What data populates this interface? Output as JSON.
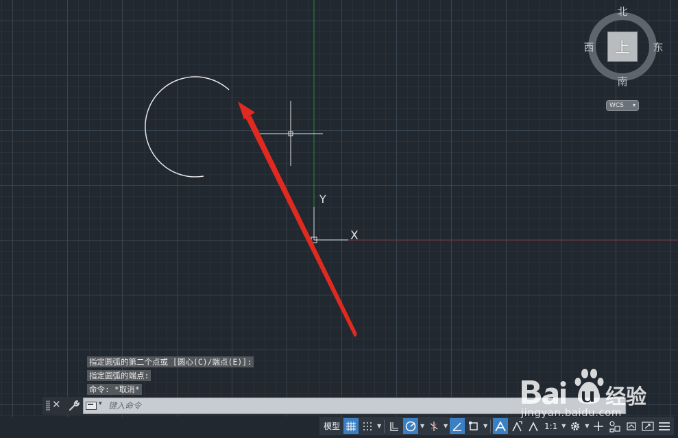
{
  "viewcube": {
    "north": "北",
    "south": "南",
    "west": "西",
    "east": "东",
    "face": "上",
    "wcs": "WCS"
  },
  "ucs": {
    "x_label": "X",
    "y_label": "Y"
  },
  "command_history": [
    "指定圆弧的第二个点或 [圆心(C)/端点(E)]:",
    "指定圆弧的端点:",
    "命令: *取消*"
  ],
  "command_line": {
    "placeholder": "键入命令"
  },
  "statusbar": {
    "model_label": "模型",
    "scale_label": "1:1",
    "icons": [
      "grid-icon",
      "snap-icon",
      "ortho-icon",
      "polar-icon",
      "isodraft-icon",
      "dynamic-ucs-icon",
      "osnap-icon",
      "annotation-icon",
      "workspace-gear-icon",
      "plus-icon",
      "isolate-icon",
      "fullscreen-icon",
      "customize-menu-icon"
    ]
  },
  "watermark": {
    "logo": "Baidu经验",
    "url": "jingyan.baidu.com"
  },
  "colors": {
    "background": "#212830",
    "x_axis": "#8a2a2a",
    "y_axis": "#2a7a3a",
    "arrow": "#e02a20",
    "active": "#3c80c4"
  }
}
